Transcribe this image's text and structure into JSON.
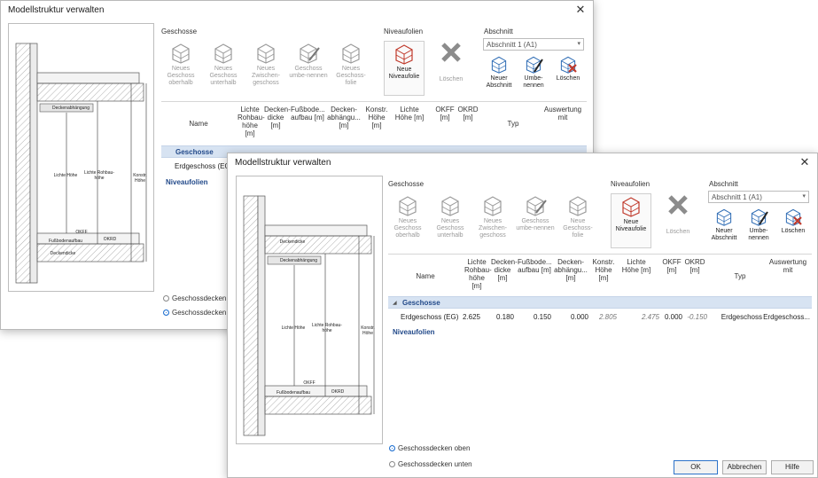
{
  "window_back": {
    "title": "Modellstruktur verwalten",
    "close_glyph": "✕",
    "sections": {
      "geschosse": "Geschosse",
      "niveaufolien": "Niveaufolien",
      "abschnitt": "Abschnitt"
    },
    "toolbar": [
      {
        "label": "Neues Geschoss oberhalb",
        "icon": "new-floor-above-icon"
      },
      {
        "label": "Neues Geschoss unterhalb",
        "icon": "new-floor-below-icon"
      },
      {
        "label": "Neues Zwischen-geschoss",
        "icon": "new-intermediate-floor-icon"
      },
      {
        "label": "Geschoss umbe-nennen",
        "icon": "rename-floor-icon"
      },
      {
        "label": "Neues Geschoss-folie",
        "icon": "new-floor-layer-icon"
      }
    ],
    "niveau_new": "Neue Niveaufolie",
    "niveau_delete": "Löschen",
    "abschnitt_select": "Abschnitt 1 (A1)",
    "abschnitt_new": "Neuer Abschnitt",
    "abschnitt_rename": "Umbe-nennen",
    "abschnitt_delete": "Löschen",
    "headers": [
      "Name",
      "Lichte Rohbau-höhe [m]",
      "Decken-dicke [m]",
      "Fußbode... aufbau [m]",
      "Decken-abhängu... [m]",
      "Konstr. Höhe [m]",
      "Lichte Höhe [m]",
      "OKFF [m]",
      "OKRD [m]",
      "Typ",
      "Auswertung mit"
    ],
    "group": "Geschosse",
    "row_name": "Erdgeschoss (EG)",
    "niveau_group": "Niveaufolien",
    "radio_top": "Geschossdecken oben",
    "radio_bottom": "Geschossdecken unten",
    "diagram_labels": {
      "deckenabhaengung": "Deckenabhängung",
      "lichte_hoehe": "Lichte Höhe",
      "lichte_rohbauhoehe": "Lichte Rohbau-höhe",
      "konstr_hoehe": "Konstr. Höhe",
      "okff": "OKFF",
      "okrd": "OKRD",
      "fussbodenaufbau": "Fußbodenaufbau",
      "deckendicke": "Deckendicke"
    }
  },
  "window_front": {
    "title": "Modellstruktur verwalten",
    "close_glyph": "✕",
    "sections": {
      "geschosse": "Geschosse",
      "niveaufolien": "Niveaufolien",
      "abschnitt": "Abschnitt"
    },
    "toolbar": [
      {
        "label": "Neues Geschoss oberhalb",
        "icon": "new-floor-above-icon"
      },
      {
        "label": "Neues Geschoss unterhalb",
        "icon": "new-floor-below-icon"
      },
      {
        "label": "Neues Zwischen-geschoss",
        "icon": "new-intermediate-floor-icon"
      },
      {
        "label": "Geschoss umbe-nennen",
        "icon": "rename-floor-icon"
      },
      {
        "label": "Neue Geschoss-folie",
        "icon": "new-floor-layer-icon"
      }
    ],
    "niveau_new": "Neue Niveaufolie",
    "niveau_delete": "Löschen",
    "abschnitt_select": "Abschnitt 1 (A1)",
    "abschnitt_new": "Neuer Abschnitt",
    "abschnitt_rename": "Umbe-nennen",
    "abschnitt_delete": "Löschen",
    "headers": [
      "Name",
      "Lichte Rohbau-höhe [m]",
      "Decken-dicke [m]",
      "Fußbode... aufbau [m]",
      "Decken-abhängu... [m]",
      "Konstr. Höhe [m]",
      "Lichte Höhe [m]",
      "OKFF [m]",
      "OKRD [m]",
      "Typ",
      "Auswertung mit"
    ],
    "group": "Geschosse",
    "row": {
      "name": "Erdgeschoss (EG)",
      "lichte_rohbauhoehe": "2.625",
      "deckendicke": "0.180",
      "fussbodenaufbau": "0.150",
      "deckenabhaengung": "0.000",
      "konstr_hoehe": "2.805",
      "lichte_hoehe": "2.475",
      "okff": "0.000",
      "okrd": "-0.150",
      "typ": "Erdgeschoss",
      "auswertung": "Erdgeschoss..."
    },
    "niveau_group": "Niveaufolien",
    "radio_top": "Geschossdecken oben",
    "radio_bottom": "Geschossdecken unten",
    "ok_label": "OK",
    "cancel_label": "Abbrechen",
    "help_label": "Hilfe",
    "diagram_labels": {
      "deckendicke": "Deckendicke",
      "deckenabhaengung": "Deckenabhängung",
      "lichte_hoehe": "Lichte Höhe",
      "lichte_rohbauhoehe": "Lichte Rohbau-höhe",
      "konstr_hoehe": "Konstr. Höhe",
      "okff": "OKFF",
      "okrd": "OKRD",
      "fussbodenaufbau": "Fußbodenaufbau"
    }
  }
}
